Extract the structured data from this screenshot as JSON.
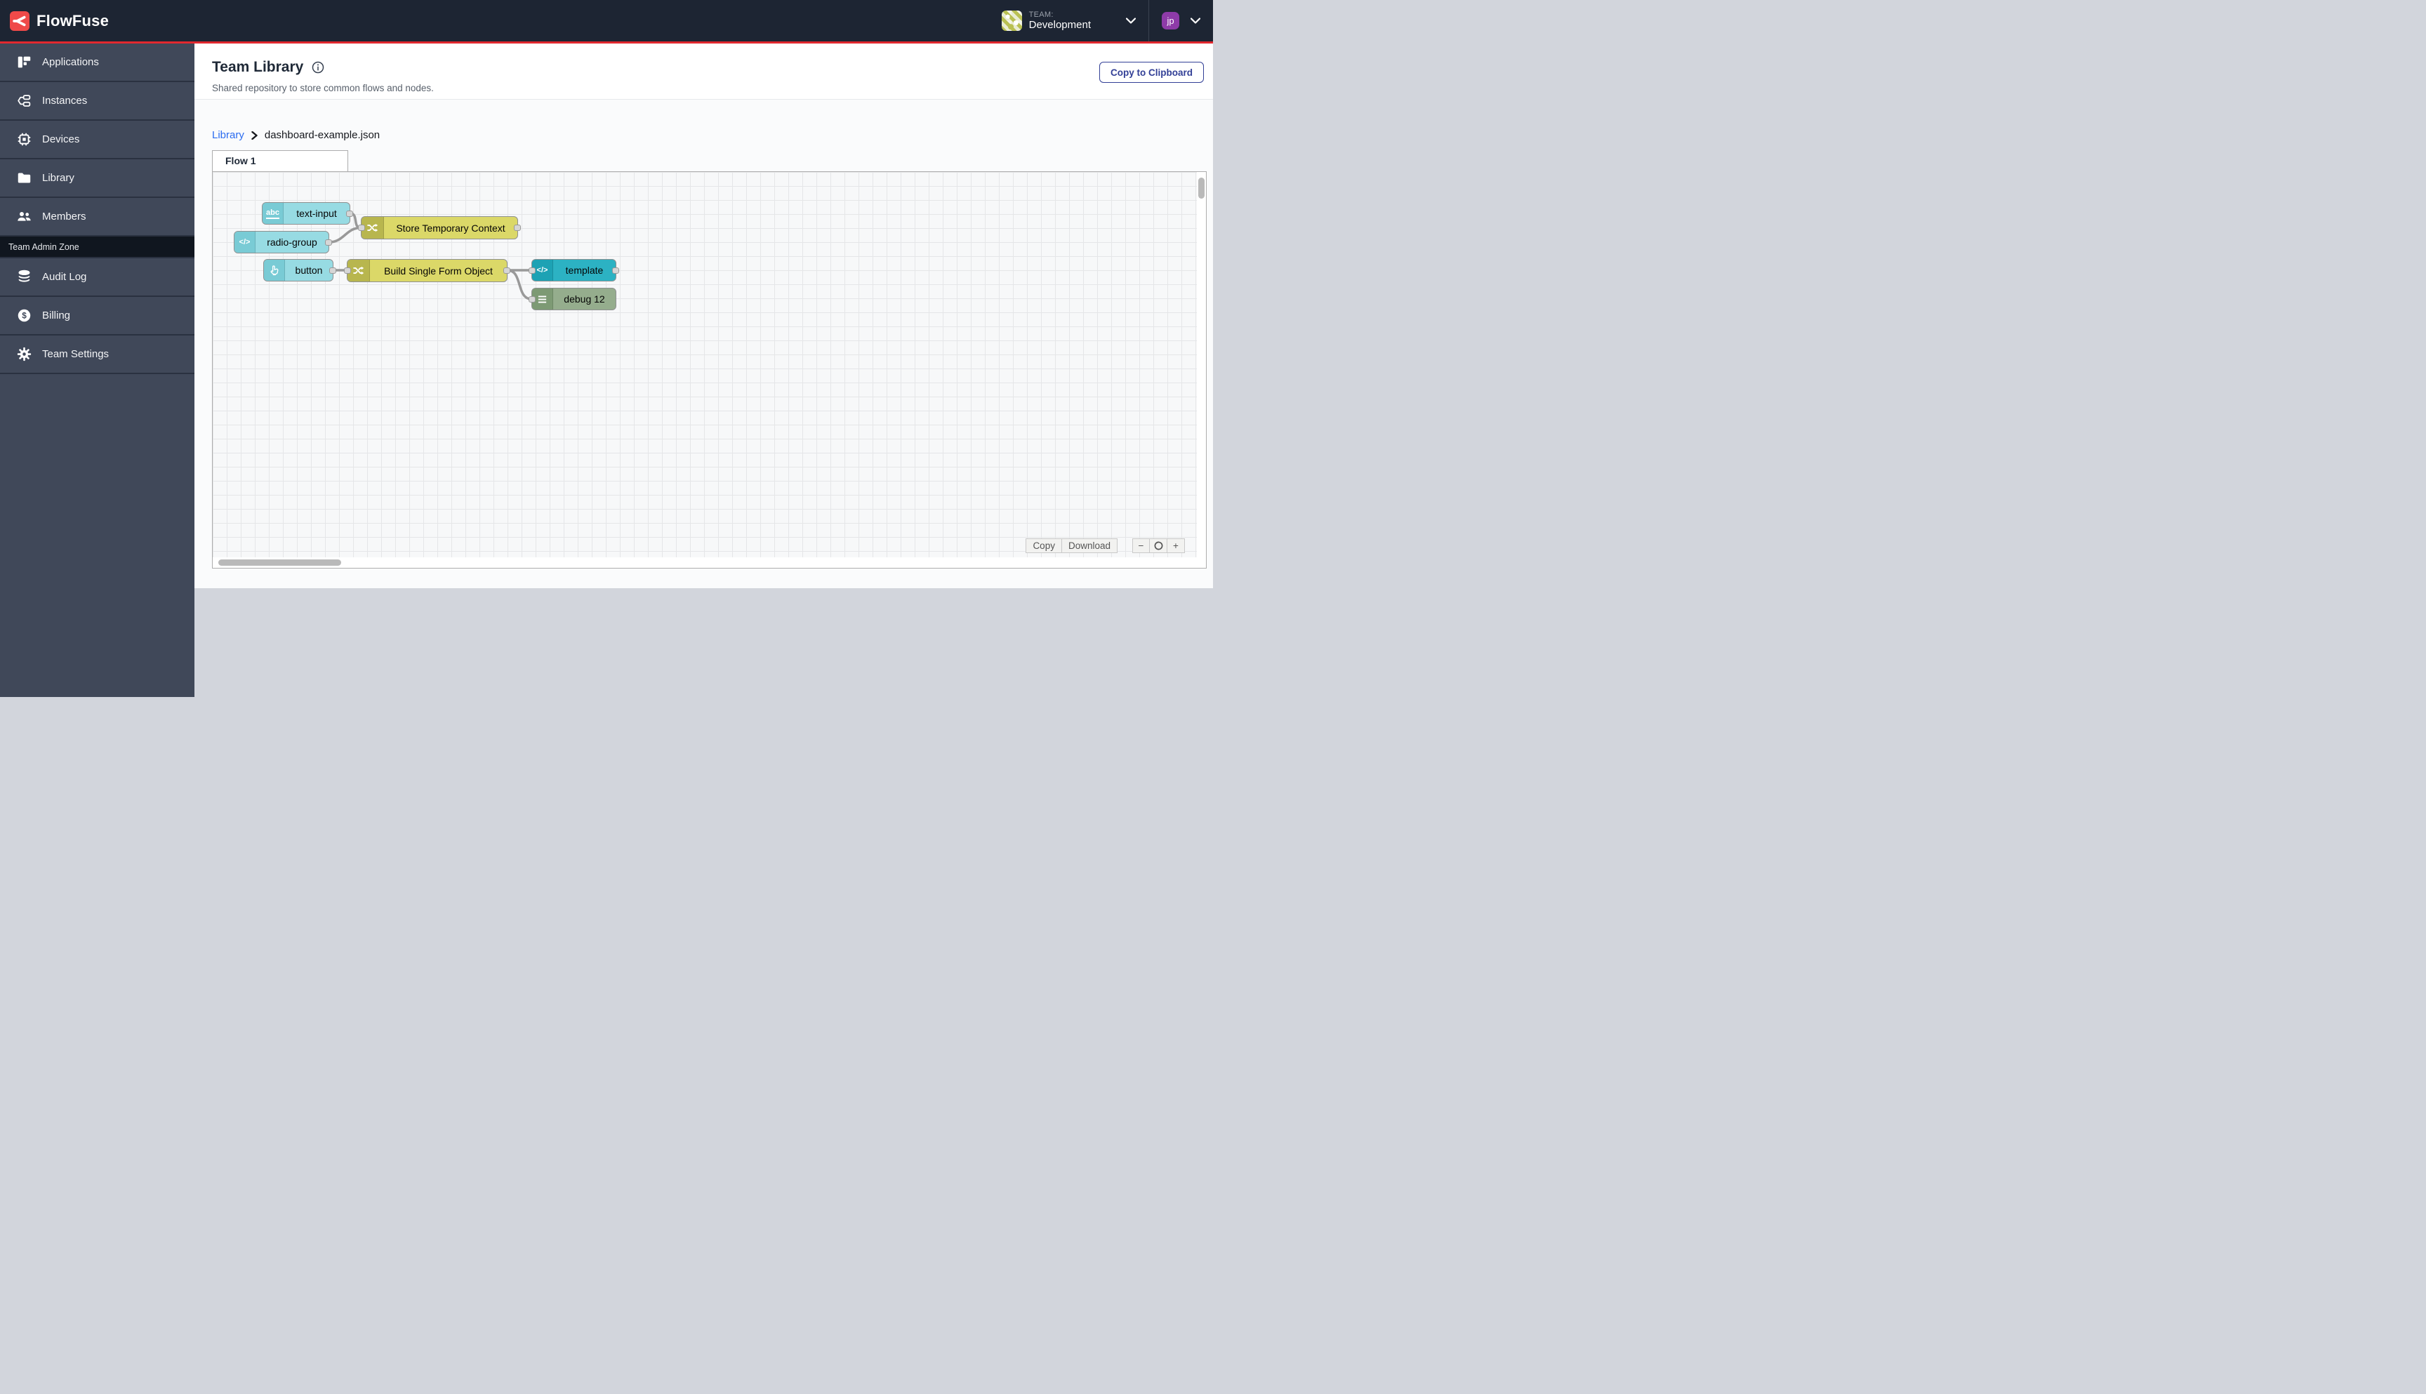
{
  "header": {
    "logo_text": "FlowFuse",
    "team_label": "TEAM:",
    "team_name": "Development",
    "user_initials": "jp"
  },
  "sidebar": {
    "items": [
      {
        "label": "Applications",
        "icon": "applications-icon"
      },
      {
        "label": "Instances",
        "icon": "instances-icon"
      },
      {
        "label": "Devices",
        "icon": "devices-icon"
      },
      {
        "label": "Library",
        "icon": "library-icon"
      },
      {
        "label": "Members",
        "icon": "members-icon"
      }
    ],
    "admin_section_label": "Team Admin Zone",
    "admin_items": [
      {
        "label": "Audit Log",
        "icon": "audit-log-icon"
      },
      {
        "label": "Billing",
        "icon": "billing-icon"
      },
      {
        "label": "Team Settings",
        "icon": "settings-icon"
      }
    ]
  },
  "page": {
    "title": "Team Library",
    "subtitle": "Shared repository to store common flows and nodes.",
    "copy_to_clipboard_label": "Copy to Clipboard"
  },
  "breadcrumb": {
    "root": "Library",
    "current": "dashboard-example.json"
  },
  "flow": {
    "tab_label": "Flow 1",
    "nodes": [
      {
        "label": "text-input",
        "type": "widget",
        "icon": "abc-icon"
      },
      {
        "label": "radio-group",
        "type": "widget",
        "icon": "code-icon"
      },
      {
        "label": "Store Temporary Context",
        "type": "change",
        "icon": "shuffle-icon"
      },
      {
        "label": "button",
        "type": "widget",
        "icon": "hand-pointer-icon"
      },
      {
        "label": "Build Single Form Object",
        "type": "change",
        "icon": "shuffle-icon"
      },
      {
        "label": "template",
        "type": "template",
        "icon": "code-icon"
      },
      {
        "label": "debug 12",
        "type": "debug",
        "icon": "list-icon"
      }
    ],
    "controls": {
      "copy_label": "Copy",
      "download_label": "Download",
      "zoom_out_label": "−",
      "zoom_in_label": "+"
    }
  },
  "colors": {
    "accent_red": "#e1282e",
    "header_bg": "#1d2533",
    "sidebar_bg": "#404859",
    "widget_node": "#97dbe3",
    "change_node": "#dbd868",
    "template_node": "#2cb2c3",
    "debug_node": "#95ad8d",
    "link_blue": "#2b6cf0",
    "button_indigo": "#323f96"
  },
  "icon_texts": {
    "abc": "abc",
    "code": "</>"
  }
}
